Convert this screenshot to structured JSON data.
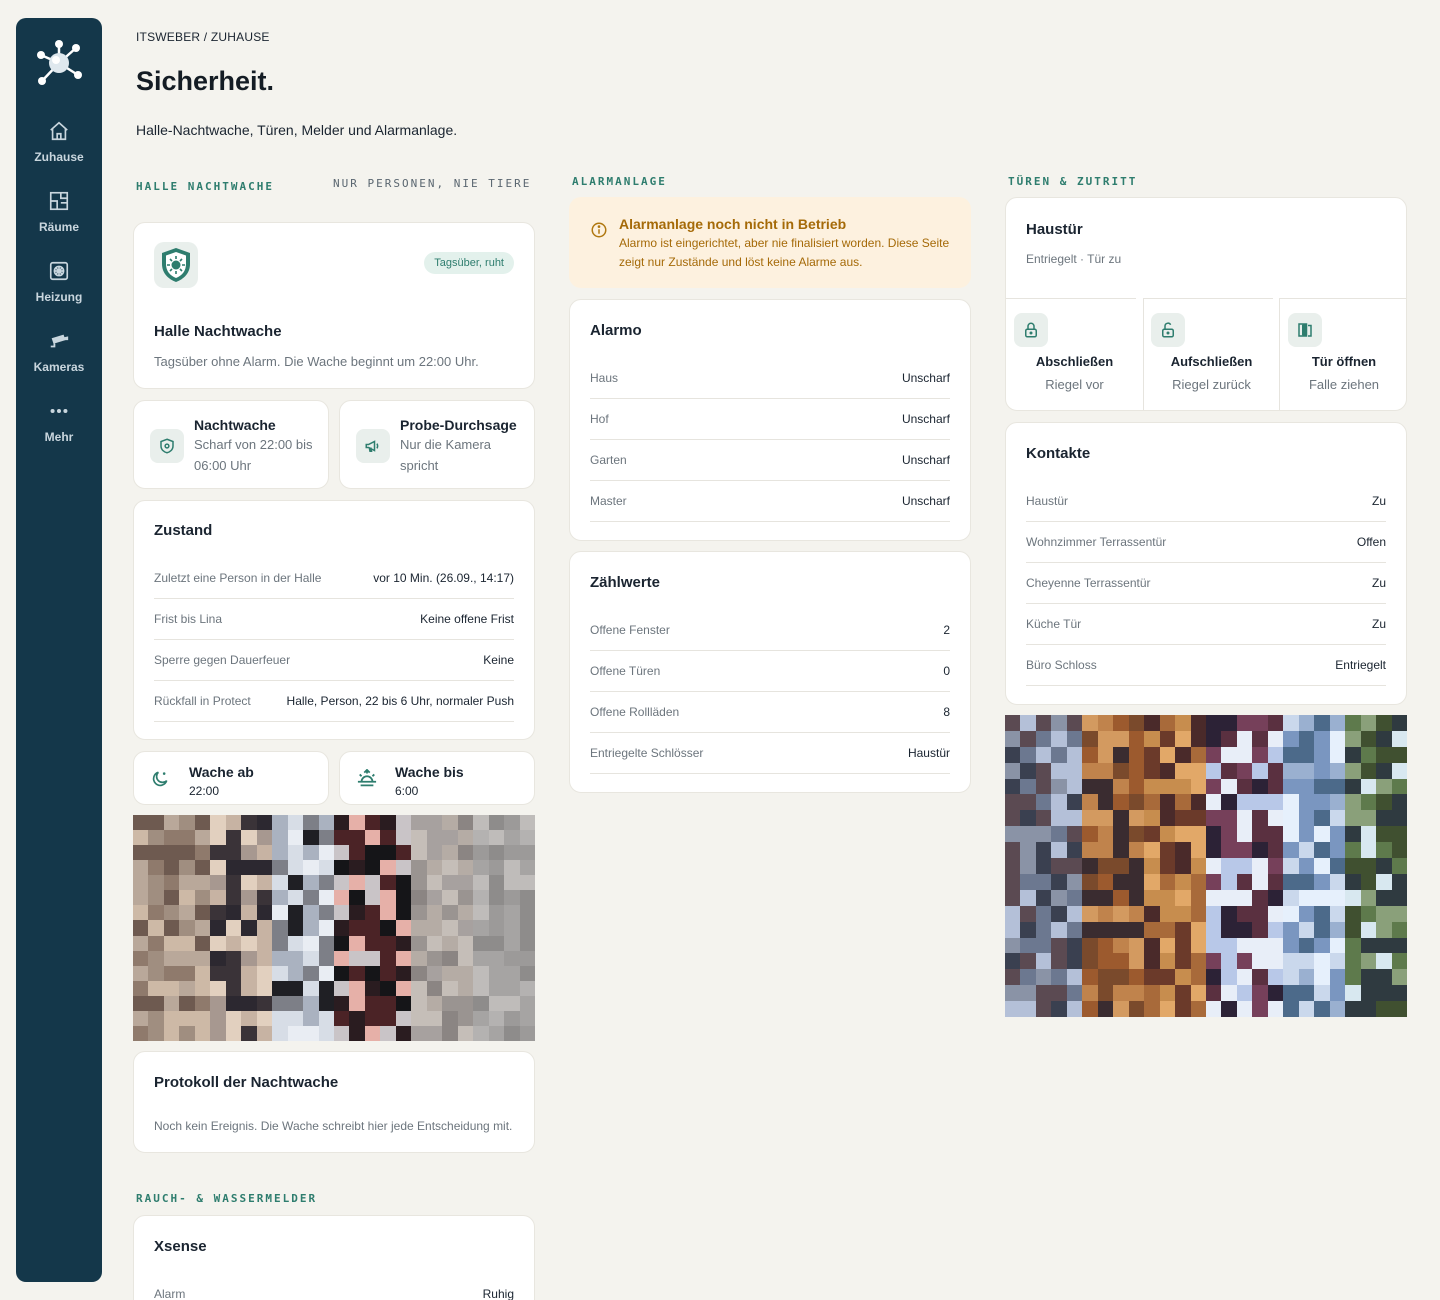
{
  "sidebar": {
    "items": [
      {
        "label": "Zuhause",
        "icon": "home-icon"
      },
      {
        "label": "Räume",
        "icon": "floorplan-icon"
      },
      {
        "label": "Heizung",
        "icon": "radiator-icon"
      },
      {
        "label": "Kameras",
        "icon": "camera-icon"
      },
      {
        "label": "Mehr",
        "icon": "more-icon"
      }
    ]
  },
  "header": {
    "breadcrumb": "ITSWEBER / ZUHAUSE",
    "title": "Sicherheit.",
    "subtitle": "Halle-Nachtwache, Türen, Melder und Alarmanlage."
  },
  "halle": {
    "section_label": "HALLE NACHTWACHE",
    "section_note": "NUR PERSONEN, NIE TIERE",
    "badge": "Tagsüber, ruht",
    "title": "Halle Nachtwache",
    "text": "Tagsüber ohne Alarm. Die Wache beginnt um 22:00 Uhr.",
    "tiles": [
      {
        "title": "Nachtwache",
        "line1": "Scharf von 22:00 bis",
        "line2": "06:00 Uhr"
      },
      {
        "title": "Probe-Durchsage",
        "line1": "Nur die Kamera",
        "line2": "spricht"
      }
    ],
    "zustand": {
      "title": "Zustand",
      "rows": [
        {
          "k": "Zuletzt eine Person in der Halle",
          "v": "vor 10 Min. (26.09., 14:17)"
        },
        {
          "k": "Frist bis Lina",
          "v": "Keine offene Frist"
        },
        {
          "k": "Sperre gegen Dauerfeuer",
          "v": "Keine"
        },
        {
          "k": "Rückfall in Protect",
          "v": "Halle, Person, 22 bis 6 Uhr, normaler Push"
        }
      ]
    },
    "times": [
      {
        "label": "Wache ab",
        "value": "22:00"
      },
      {
        "label": "Wache bis",
        "value": "6:00"
      }
    ],
    "protokoll": {
      "title": "Protokoll der Nachtwache",
      "text": "Noch kein Ereignis. Die Wache schreibt hier jede Entscheidung mit."
    }
  },
  "rauch": {
    "section_label": "RAUCH- & WASSERMELDER",
    "title": "Xsense",
    "rows": [
      {
        "k": "Alarm",
        "v": "Ruhig"
      }
    ]
  },
  "alarm": {
    "section_label": "ALARMANLAGE",
    "warning_title": "Alarmanlage noch nicht in Betrieb",
    "warning_text": "Alarmo ist eingerichtet, aber nie finalisiert worden. Diese Seite zeigt nur Zustände und löst keine Alarme aus.",
    "alarmo": {
      "title": "Alarmo",
      "rows": [
        {
          "k": "Haus",
          "v": "Unscharf"
        },
        {
          "k": "Hof",
          "v": "Unscharf"
        },
        {
          "k": "Garten",
          "v": "Unscharf"
        },
        {
          "k": "Master",
          "v": "Unscharf"
        }
      ]
    },
    "zaehlwerte": {
      "title": "Zählwerte",
      "rows": [
        {
          "k": "Offene Fenster",
          "v": "2"
        },
        {
          "k": "Offene Türen",
          "v": "0"
        },
        {
          "k": "Offene Rollläden",
          "v": "8"
        },
        {
          "k": "Entriegelte Schlösser",
          "v": "Haustür"
        }
      ]
    }
  },
  "tueren": {
    "section_label": "TÜREN & ZUTRITT",
    "haustuer": {
      "title": "Haustür",
      "status": "Entriegelt · Tür zu",
      "actions": [
        {
          "label": "Abschließen",
          "sub": "Riegel vor",
          "icon": "lock-icon"
        },
        {
          "label": "Aufschließen",
          "sub": "Riegel zurück",
          "icon": "unlock-icon"
        },
        {
          "label": "Tür öffnen",
          "sub": "Falle ziehen",
          "icon": "door-open-icon"
        }
      ]
    },
    "kontakte": {
      "title": "Kontakte",
      "rows": [
        {
          "k": "Haustür",
          "v": "Zu"
        },
        {
          "k": "Wohnzimmer Terrassentür",
          "v": "Offen"
        },
        {
          "k": "Cheyenne Terrassentür",
          "v": "Zu"
        },
        {
          "k": "Küche Tür",
          "v": "Zu"
        },
        {
          "k": "Büro Schloss",
          "v": "Entriegelt"
        }
      ]
    }
  },
  "colors": {
    "accent": "#2e7d6e",
    "sidebar": "#14374a",
    "background": "#f4f3ee",
    "warning_bg": "#fdf1df",
    "warning_text": "#a56a08"
  }
}
